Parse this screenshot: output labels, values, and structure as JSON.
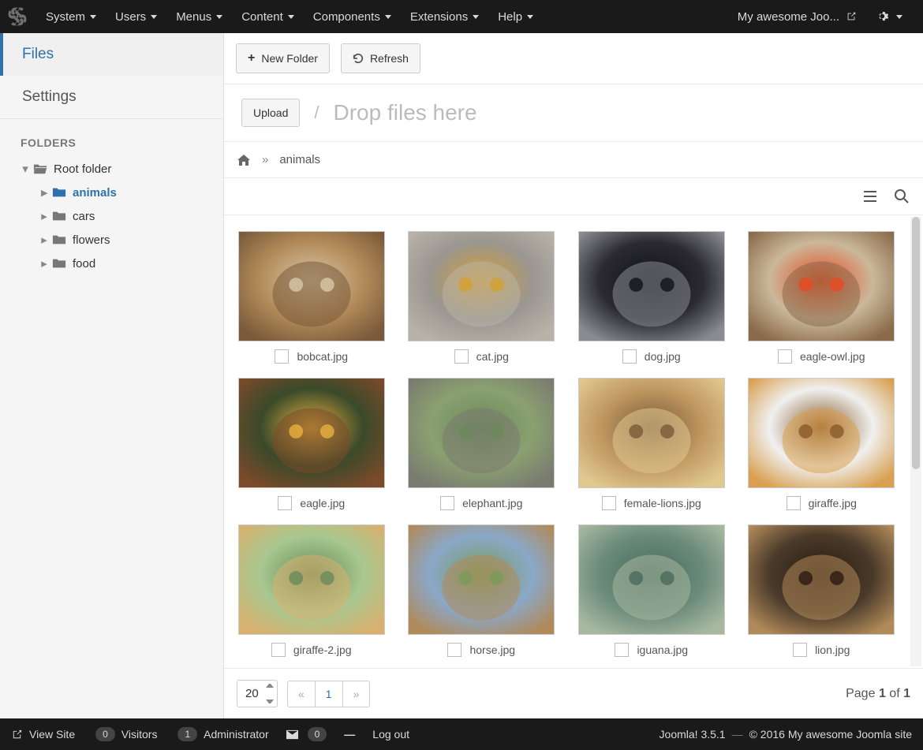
{
  "topmenu": [
    "System",
    "Users",
    "Menus",
    "Content",
    "Components",
    "Extensions",
    "Help"
  ],
  "site_title": "My awesome Joo...",
  "sidebar": {
    "nav": [
      "Files",
      "Settings"
    ],
    "active": 0,
    "folders_head": "FOLDERS",
    "root": "Root folder",
    "children": [
      "animals",
      "cars",
      "flowers",
      "food"
    ],
    "active_child": 0
  },
  "toolbar": {
    "new_folder": "New Folder",
    "refresh": "Refresh"
  },
  "upload": {
    "label": "Upload",
    "slash": "/",
    "hint": "Drop files here"
  },
  "breadcrumbs": {
    "sep": "»",
    "last": "animals"
  },
  "files": [
    {
      "name": "bobcat.jpg",
      "palette": [
        "#b38b5a",
        "#7a5a3a",
        "#d8c8a8"
      ]
    },
    {
      "name": "cat.jpg",
      "palette": [
        "#9a9690",
        "#b8b2a8",
        "#d4a030"
      ]
    },
    {
      "name": "dog.jpg",
      "palette": [
        "#2a2a30",
        "#8a8a92",
        "#111118"
      ]
    },
    {
      "name": "eagle-owl.jpg",
      "palette": [
        "#cab89a",
        "#8a6a4a",
        "#e84a20"
      ]
    },
    {
      "name": "eagle.jpg",
      "palette": [
        "#3a4a2a",
        "#7a4a2a",
        "#e8b040"
      ]
    },
    {
      "name": "elephant.jpg",
      "palette": [
        "#8aa070",
        "#7a7a70",
        "#6a8a5a"
      ]
    },
    {
      "name": "female-lions.jpg",
      "palette": [
        "#c09860",
        "#e0c890",
        "#7a5a3a"
      ]
    },
    {
      "name": "giraffe.jpg",
      "palette": [
        "#f0f0f0",
        "#d8a050",
        "#8a5a2a"
      ]
    },
    {
      "name": "giraffe-2.jpg",
      "palette": [
        "#a8c890",
        "#d8b070",
        "#6a8a5a"
      ]
    },
    {
      "name": "horse.jpg",
      "palette": [
        "#8aa8c8",
        "#b08a5a",
        "#7a9a5a"
      ]
    },
    {
      "name": "iguana.jpg",
      "palette": [
        "#6a8a7a",
        "#a8b8a0",
        "#4a6a5a"
      ]
    },
    {
      "name": "lion.jpg",
      "palette": [
        "#4a3a2a",
        "#b08a5a",
        "#2a1a10"
      ]
    }
  ],
  "pager": {
    "pagesize": "20",
    "prev": "«",
    "page": "1",
    "next": "»",
    "page_word": "Page",
    "cur": "1",
    "of": "of",
    "total": "1"
  },
  "status": {
    "view_site": "View Site",
    "visitors": {
      "count": "0",
      "label": "Visitors"
    },
    "admin": {
      "count": "1",
      "label": "Administrator"
    },
    "messages": "0",
    "no_requests": "—",
    "logout": "Log out",
    "version": "Joomla! 3.5.1",
    "sep": "—",
    "copyright": "© 2016 My awesome Joomla site"
  }
}
